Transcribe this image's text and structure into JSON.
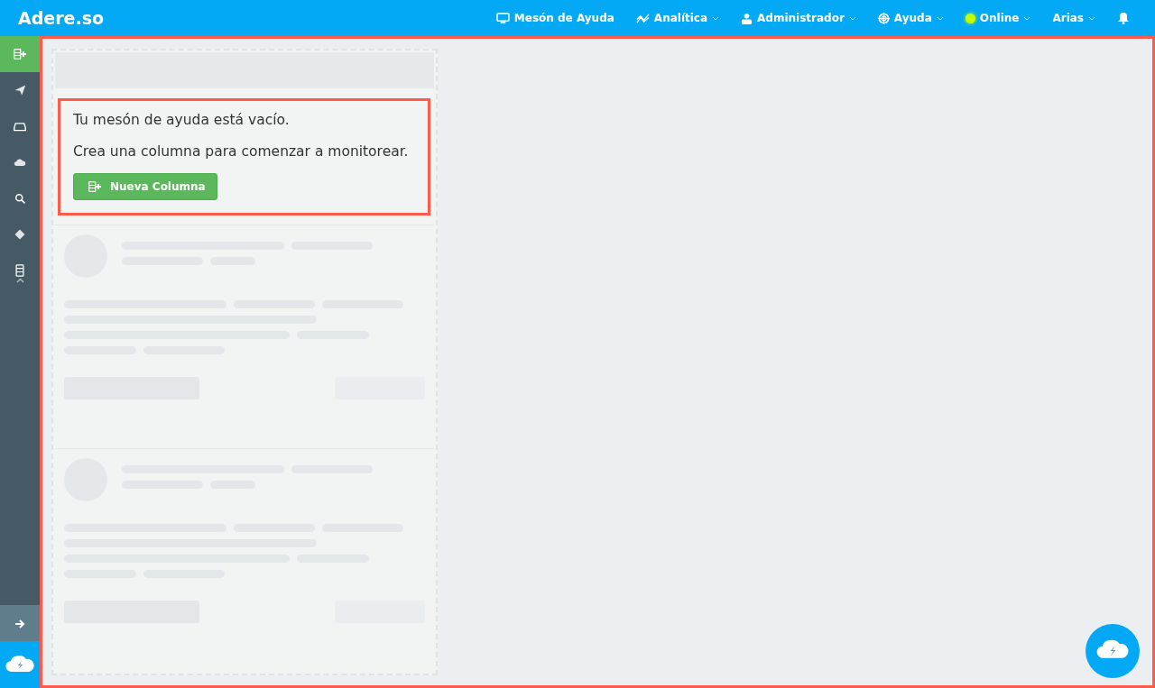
{
  "navbar": {
    "brand": "Adere.so",
    "items": [
      {
        "label": "Mesón de Ayuda",
        "dropdown": false
      },
      {
        "label": "Analítica",
        "dropdown": true
      },
      {
        "label": "Administrador",
        "dropdown": true
      },
      {
        "label": "Ayuda",
        "dropdown": true
      },
      {
        "label": "Online",
        "dropdown": true,
        "color": "#c6ff00"
      },
      {
        "label": "Arias",
        "dropdown": true
      }
    ]
  },
  "sidebar": {
    "items": [
      {
        "selected": true
      },
      {
        "selected": false
      },
      {
        "selected": false
      },
      {
        "selected": false
      },
      {
        "selected": false
      },
      {
        "selected": false
      },
      {
        "selected": false
      }
    ]
  },
  "column": {
    "empty_title": "Tu mesón de ayuda está vacío.",
    "empty_text": "Crea una columna para comenzar a monitorear.",
    "button": "Nueva Columna"
  }
}
